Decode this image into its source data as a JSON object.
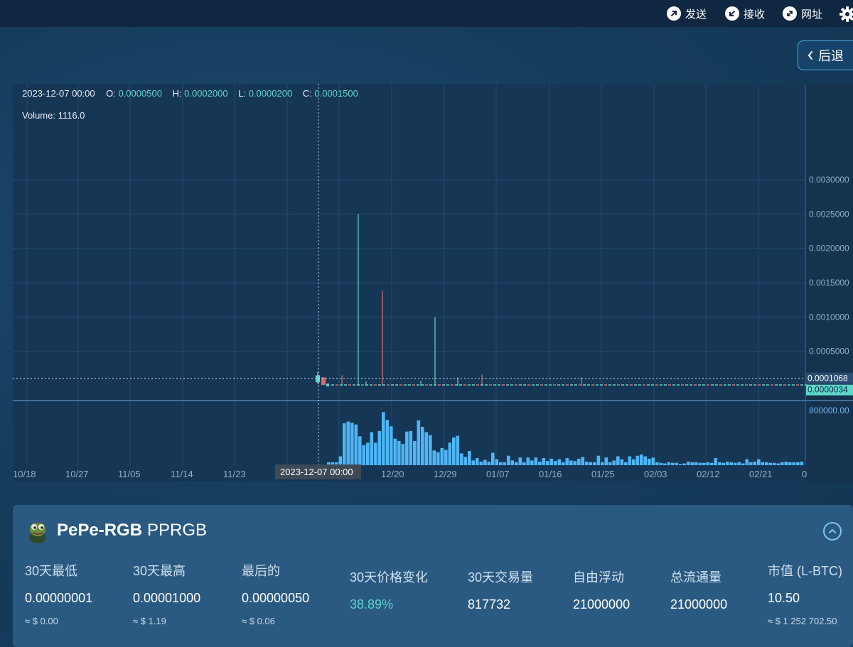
{
  "top_bar": {
    "send_label": "发送",
    "receive_label": "接收",
    "url_label": "网址"
  },
  "back_button": {
    "label": "后退"
  },
  "chart_data": {
    "type": "candlestick",
    "ohlc_readout": {
      "date": "2023-12-07 00:00",
      "o_label": "O:",
      "o": "0.0000500",
      "h_label": "H:",
      "h": "0.0002000",
      "l_label": "L:",
      "l": "0.0000200",
      "c_label": "C:",
      "c": "0.0001500"
    },
    "volume_readout": "Volume: 1116.0",
    "price_axis_ticks": [
      "0.0030000",
      "0.0025000",
      "0.0020000",
      "0.0015000",
      "0.0010000",
      "0.0005000"
    ],
    "price_ylim": [
      0,
      0.003
    ],
    "current_price_label": "0.0001068",
    "last_price_label": "0.0000034",
    "volume_axis_tick": "800000.00",
    "x_tick_labels": [
      "10/18",
      "10/27",
      "11/05",
      "11/14",
      "11/23",
      "12/20",
      "12/29",
      "01/07",
      "01/16",
      "01/25",
      "02/03",
      "02/12",
      "02/21",
      "0"
    ],
    "crosshair_label": "2023-12-07 00:00",
    "volumes": [
      0.05,
      0.05,
      0.05,
      0.15,
      0.71,
      0.74,
      0.72,
      0.69,
      0.49,
      0.34,
      0.38,
      0.56,
      0.38,
      0.58,
      0.9,
      0.77,
      0.66,
      0.45,
      0.41,
      0.36,
      0.57,
      0.58,
      0.41,
      0.76,
      0.65,
      0.56,
      0.51,
      0.25,
      0.22,
      0.29,
      0.26,
      0.38,
      0.47,
      0.5,
      0.2,
      0.14,
      0.24,
      0.08,
      0.12,
      0.06,
      0.09,
      0.06,
      0.21,
      0.1,
      0.05,
      0.05,
      0.16,
      0.08,
      0.05,
      0.13,
      0.05,
      0.13,
      0.08,
      0.13,
      0.06,
      0.12,
      0.07,
      0.11,
      0.07,
      0.1,
      0.05,
      0.12,
      0.08,
      0.07,
      0.11,
      0.14,
      0.06,
      0.05,
      0.05,
      0.16,
      0.05,
      0.13,
      0.05,
      0.08,
      0.15,
      0.1,
      0.05,
      0.15,
      0.1,
      0.16,
      0.18,
      0.15,
      0.11,
      0.13,
      0.05,
      0.04,
      0.03,
      0.05,
      0.04,
      0.04,
      0.02,
      0.03,
      0.06,
      0.05,
      0.05,
      0.04,
      0.04,
      0.05,
      0.04,
      0.12,
      0.05,
      0.04,
      0.06,
      0.05,
      0.04,
      0.05,
      0.03,
      0.1,
      0.05,
      0.06,
      0.1,
      0.05,
      0.05,
      0.04,
      0.04,
      0.03,
      0.05,
      0.06,
      0.05,
      0.05,
      0.05,
      0.06,
      0.04,
      0.05
    ]
  },
  "token": {
    "name": "PePe-RGB",
    "symbol": "PPRGB"
  },
  "stats": [
    {
      "label": "30天最低",
      "value": "0.00000001",
      "usd": "≈ $ 0.00"
    },
    {
      "label": "30天最高",
      "value": "0.00001000",
      "usd": "≈ $ 1.19"
    },
    {
      "label": "最后的",
      "value": "0.00000050",
      "usd": "≈ $ 0.06"
    },
    {
      "label": "30天价格变化",
      "value": "38.89%",
      "usd": "",
      "accent": "#5ed6c9"
    },
    {
      "label": "30天交易量",
      "value": "817732",
      "usd": ""
    },
    {
      "label": "自由浮动",
      "value": "21000000",
      "usd": ""
    },
    {
      "label": "总流通量",
      "value": "21000000",
      "usd": ""
    },
    {
      "label": "市值 (L-BTC)",
      "value": "10.50",
      "usd": "≈ $ 1 252 702.50"
    }
  ],
  "colors": {
    "up": "#5ed6c9",
    "down": "#e06a6a",
    "volume": "#4fb6f5"
  }
}
